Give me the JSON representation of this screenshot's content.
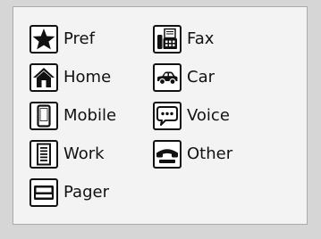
{
  "legend": {
    "items": [
      {
        "label": "Pref",
        "icon": "star-icon"
      },
      {
        "label": "Home",
        "icon": "home-icon"
      },
      {
        "label": "Mobile",
        "icon": "mobile-phone-icon"
      },
      {
        "label": "Work",
        "icon": "building-icon"
      },
      {
        "label": "Pager",
        "icon": "pager-icon"
      },
      {
        "label": "Fax",
        "icon": "fax-icon"
      },
      {
        "label": "Car",
        "icon": "car-icon"
      },
      {
        "label": "Voice",
        "icon": "speech-bubble-icon"
      },
      {
        "label": "Other",
        "icon": "telephone-handset-icon"
      }
    ]
  },
  "colors": {
    "background": "#d6d6d6",
    "panel": "#f3f3f3",
    "icon": "#111111"
  }
}
